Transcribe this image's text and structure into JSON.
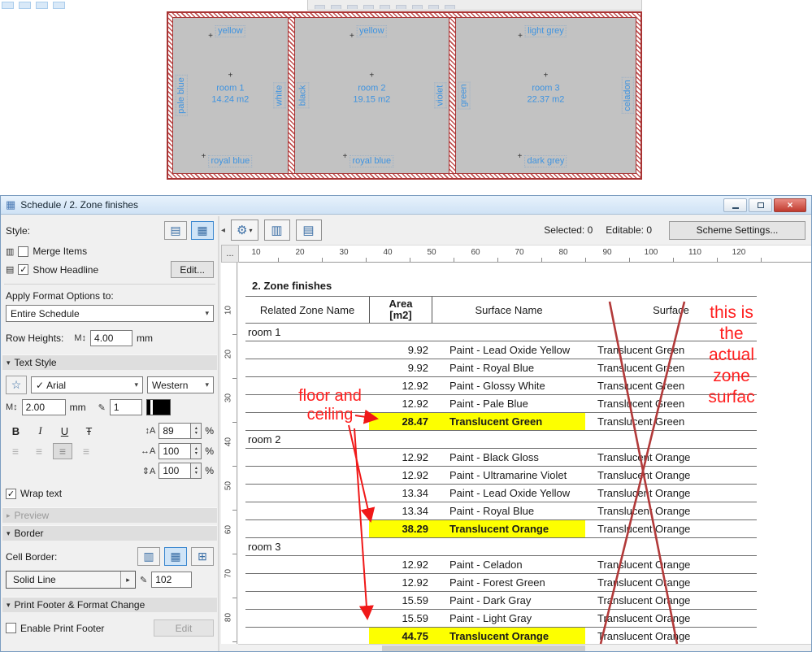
{
  "chrome": {
    "title": "Schedule / 2. Zone finishes",
    "selected": "Selected: 0",
    "editable": "Editable: 0",
    "scheme_settings": "Scheme Settings...",
    "ruler_corner": "..."
  },
  "icons": {
    "window": "▦",
    "close": "×",
    "collapse_left": "◂",
    "gear": "⚙",
    "dropdown": "▾",
    "flyout": "▸",
    "spin_up": "▴",
    "spin_down": "▾",
    "check": "✓",
    "section_open": "▾",
    "section_closed": "▸",
    "style_flat": "▤",
    "style_grid": "▦",
    "restructure": "▥",
    "format": "▤",
    "row_height_m": "M",
    "updown": "↕",
    "favorites": "☆",
    "pen": "✎",
    "bold": "B",
    "italic": "I",
    "underline": "U",
    "strike": "Ŧ",
    "align": "≡",
    "size_factor": "↕A",
    "width_factor": "↔A",
    "spacing_factor": "⇕A",
    "cell_border_a": "▥",
    "cell_border_b": "▦",
    "cell_border_c": "⊞"
  },
  "sidebar": {
    "style_label": "Style:",
    "merge_items_label": "Merge Items",
    "show_headline_label": "Show Headline",
    "edit_headline_button": "Edit...",
    "apply_format_label": "Apply Format Options to:",
    "apply_format_value": "Entire Schedule",
    "row_heights_label": "Row Heights:",
    "row_heights_value": "4.00",
    "row_heights_unit": "mm",
    "text_style_section": "Text Style",
    "font_value": "Arial",
    "script_value": "Western",
    "font_size_value": "2.00",
    "font_size_unit": "mm",
    "font_pen_value": "1",
    "scale_value": "89",
    "width_value": "100",
    "spacing_value": "100",
    "percent": "%",
    "wrap_text_label": "Wrap text",
    "preview_section": "Preview",
    "border_section": "Border",
    "cell_border_label": "Cell Border:",
    "line_type_value": "Solid Line",
    "border_pen_value": "102",
    "print_footer_section": "Print Footer & Format Change",
    "enable_print_footer_label": "Enable Print Footer",
    "edit_footer_button": "Edit"
  },
  "ruler": {
    "h": [
      "10",
      "20",
      "30",
      "40",
      "50",
      "60",
      "70",
      "80",
      "90",
      "100",
      "110",
      "120"
    ],
    "v": [
      "10",
      "20",
      "30",
      "40",
      "50",
      "60",
      "70",
      "80"
    ]
  },
  "table": {
    "title": "2. Zone finishes",
    "columns": [
      "Related Zone Name",
      "Area\n[m2]",
      "Surface Name",
      "Surface"
    ],
    "groups": [
      {
        "name": "room 1",
        "rows": [
          {
            "area": "9.92",
            "surface_name": "Paint - Lead Oxide Yellow",
            "surface": "Translucent Green",
            "highlight": false
          },
          {
            "area": "9.92",
            "surface_name": "Paint - Royal Blue",
            "surface": "Translucent Green",
            "highlight": false
          },
          {
            "area": "12.92",
            "surface_name": "Paint - Glossy White",
            "surface": "Translucent Green",
            "highlight": false
          },
          {
            "area": "12.92",
            "surface_name": "Paint - Pale Blue",
            "surface": "Translucent Green",
            "highlight": false
          },
          {
            "area": "28.47",
            "surface_name": "Translucent Green",
            "surface": "Translucent Green",
            "highlight": true
          }
        ]
      },
      {
        "name": "room 2",
        "rows": [
          {
            "area": "12.92",
            "surface_name": "Paint - Black Gloss",
            "surface": "Translucent Orange",
            "highlight": false
          },
          {
            "area": "12.92",
            "surface_name": "Paint - Ultramarine Violet",
            "surface": "Translucent Orange",
            "highlight": false
          },
          {
            "area": "13.34",
            "surface_name": "Paint - Lead Oxide Yellow",
            "surface": "Translucent Orange",
            "highlight": false
          },
          {
            "area": "13.34",
            "surface_name": "Paint - Royal Blue",
            "surface": "Translucent Orange",
            "highlight": false
          },
          {
            "area": "38.29",
            "surface_name": "Translucent Orange",
            "surface": "Translucent Orange",
            "highlight": true
          }
        ]
      },
      {
        "name": "room 3",
        "rows": [
          {
            "area": "12.92",
            "surface_name": "Paint - Celadon",
            "surface": "Translucent Orange",
            "highlight": false
          },
          {
            "area": "12.92",
            "surface_name": "Paint - Forest Green",
            "surface": "Translucent Orange",
            "highlight": false
          },
          {
            "area": "15.59",
            "surface_name": "Paint - Dark Gray",
            "surface": "Translucent Orange",
            "highlight": false
          },
          {
            "area": "15.59",
            "surface_name": "Paint - Light Gray",
            "surface": "Translucent Orange",
            "highlight": false
          },
          {
            "area": "44.75",
            "surface_name": "Translucent Orange",
            "surface": "Translucent Orange",
            "highlight": true
          }
        ]
      }
    ]
  },
  "plan": {
    "rooms": [
      {
        "name": "room 1",
        "area_label": "14.24 m2",
        "labels": {
          "top": "yellow",
          "left": "pale blue",
          "right": "white",
          "bottom": "royal blue"
        }
      },
      {
        "name": "room 2",
        "area_label": "19.15 m2",
        "labels": {
          "top": "yellow",
          "left": "black",
          "right": "violet",
          "bottom": "royal blue"
        }
      },
      {
        "name": "room 3",
        "area_label": "22.37 m2",
        "labels": {
          "top": "light grey",
          "left": "green",
          "right": "celadon",
          "bottom": "dark grey"
        }
      }
    ]
  },
  "annotations": {
    "floor_ceiling": "floor and\nceiling",
    "zone_note": "this is\nthe\nactual\nzone\nsurfac"
  }
}
